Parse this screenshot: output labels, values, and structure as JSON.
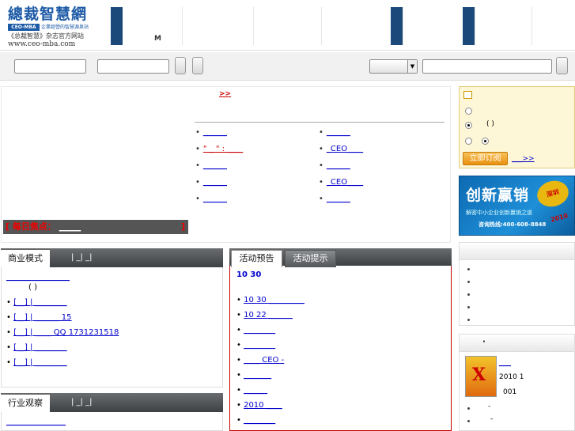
{
  "header": {
    "logo_cn": "總裁智慧網",
    "logo_badge": "CEO-MBA",
    "logo_tagline": "企業經營的智慧源泉站",
    "logo_sub": "《总裁智慧》杂志官方网站",
    "logo_url": "www.ceo-mba.com",
    "nav_m": "M"
  },
  "search": {
    "input1": "",
    "input2": "",
    "select_value": "",
    "input3": ""
  },
  "focus": {
    "more": ">>",
    "left_items": [
      "______",
      "\" _ \" : ____",
      "______",
      "______",
      "______"
    ],
    "right_items": [
      "______",
      "_CEO____",
      "______",
      "_CEO____",
      "______"
    ],
    "daily_label": "[ 每日焦点：",
    "daily_link": "_____",
    "daily_end": "]"
  },
  "subscribe": {
    "paren": "(     )",
    "button": "立即订阅",
    "more": "___>>"
  },
  "ad": {
    "title": "创新赢销",
    "badge": "深圳 2010",
    "sub": "解密中小企业创新赢销之道",
    "phone": "咨询热线:400-608-8848"
  },
  "business": {
    "tab": "商业模式",
    "links": "|  _|  _|",
    "headline": "________________",
    "paren": "(          )",
    "items": [
      "[__]  |  ________",
      "[__]  |  ______ 15",
      "[__]  |  ____ QQ 1731231518",
      "[__]  |  ________",
      "[__]  |  ________"
    ]
  },
  "industry": {
    "tab": "行业观察",
    "links": "|  _|  _|",
    "headline": "_______________"
  },
  "activity": {
    "tab_on": "活动预告",
    "tab_off": "活动提示",
    "date": "10  30",
    "items": [
      "10 30 _________",
      "10 22 ______",
      "________",
      "________",
      "____ CEO  -",
      "_______",
      "______",
      "2010 ____",
      "________"
    ]
  },
  "right_list": {
    "items": [
      "",
      "",
      "",
      "",
      ""
    ]
  },
  "magazine": {
    "dot": "·",
    "link": "___",
    "issue": "2010 1",
    "num": "001",
    "bullets": [
      "-",
      "-"
    ]
  }
}
